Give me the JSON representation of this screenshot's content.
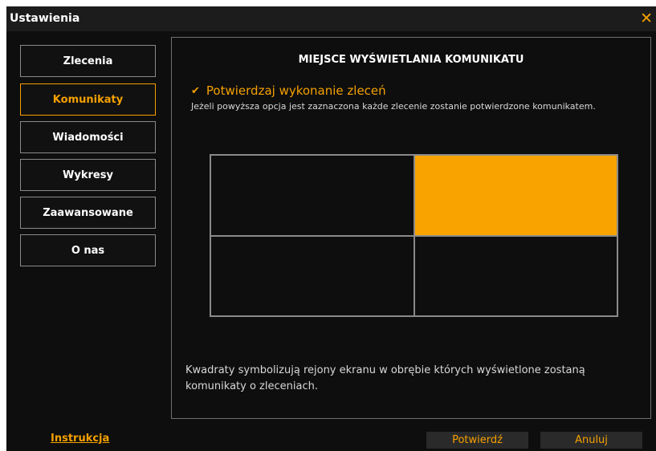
{
  "window": {
    "title": "Ustawienia"
  },
  "sidebar": {
    "items": [
      {
        "label": "Zlecenia"
      },
      {
        "label": "Komunikaty"
      },
      {
        "label": "Wiadomości"
      },
      {
        "label": "Wykresy"
      },
      {
        "label": "Zaawansowane"
      },
      {
        "label": "O nas"
      }
    ],
    "active_index": 1
  },
  "main": {
    "section_title": "MIEJSCE WYŚWIETLANIA KOMUNIKATU",
    "confirm_checkbox": {
      "label": "Potwierdzaj wykonanie zleceń",
      "checked": true
    },
    "description": "Jeżeli powyższa opcja jest zaznaczona każde zlecenie zostanie potwierdzone komunikatem.",
    "position_grid": {
      "cells": [
        "top-left",
        "top-right",
        "bottom-left",
        "bottom-right"
      ],
      "selected": "top-right"
    },
    "footnote": "Kwadraty symbolizują rejony ekranu w obrębie których wyświetlone zostaną komunikaty o zleceniach."
  },
  "footer": {
    "instructions_link": "Instrukcja",
    "confirm_label": "Potwierdź",
    "cancel_label": "Anuluj"
  },
  "colors": {
    "accent": "#f5a000",
    "background": "#0e0e0e",
    "border": "#8a8a8a"
  }
}
